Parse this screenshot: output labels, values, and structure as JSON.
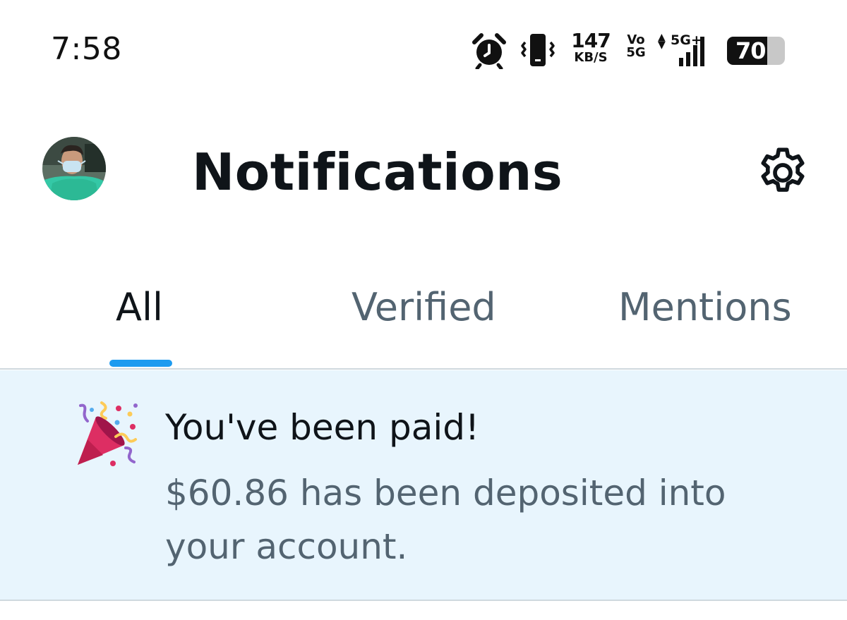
{
  "status_bar": {
    "time": "7:58",
    "net_speed_value": "147",
    "net_speed_unit": "KB/S",
    "volte_top": "Vo",
    "volte_bottom": "5G",
    "network_type": "5G+",
    "battery_level": "70",
    "battery_fraction": 0.7,
    "icons": [
      "alarm-icon",
      "vibrate-icon",
      "signal-icon",
      "battery-icon"
    ]
  },
  "header": {
    "title": "Notifications",
    "avatar": "profile-avatar",
    "settings_icon": "gear-icon"
  },
  "tabs": [
    {
      "label": "All",
      "active": true
    },
    {
      "label": "Verified",
      "active": false
    },
    {
      "label": "Mentions",
      "active": false
    }
  ],
  "notification": {
    "icon": "party-popper-icon",
    "title": "You've been paid!",
    "body": "$60.86 has been deposited into your account."
  },
  "colors": {
    "accent": "#1d9bf0",
    "notification_bg": "#e8f5fd",
    "secondary_text": "#536471",
    "primary_text": "#0f1419"
  }
}
